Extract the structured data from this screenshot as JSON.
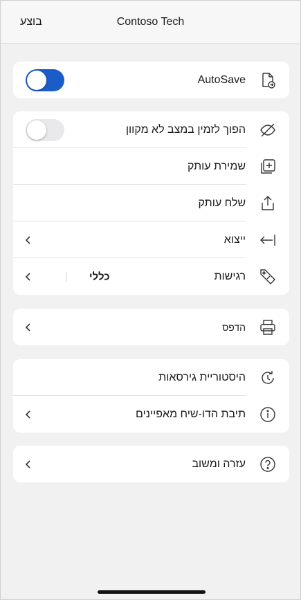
{
  "header": {
    "title": "Contoso Tech",
    "done_label": "בוצע"
  },
  "autosave": {
    "label": "AutoSave",
    "icon": "document-autosave-icon",
    "toggle_on": true
  },
  "file_group": {
    "items": [
      {
        "label": "הפוך לזמין במצב לא מקוון",
        "icon": "cloud-off-icon",
        "toggle_on": false
      },
      {
        "label": "שמירת עותק",
        "icon": "add-copy-icon"
      },
      {
        "label": "שלח עותק",
        "icon": "share-icon"
      },
      {
        "label": "ייצוא",
        "icon": "export-arrow-icon"
      },
      {
        "label": "רגישות",
        "icon": "sensitivity-label-icon",
        "value": "כללי"
      }
    ]
  },
  "print_group": {
    "label": "הדפס",
    "icon": "printer-icon"
  },
  "info_group": {
    "items": [
      {
        "label": "היסטוריית גירסאות",
        "icon": "history-icon"
      },
      {
        "label": "תיבת הדו-שיח מאפיינים",
        "icon": "info-icon"
      }
    ]
  },
  "help_group": {
    "label": "עזרה ומשוב",
    "icon": "help-icon"
  },
  "colors": {
    "accent": "#1a5dc8",
    "background": "#f1f1f1",
    "card": "#ffffff"
  }
}
